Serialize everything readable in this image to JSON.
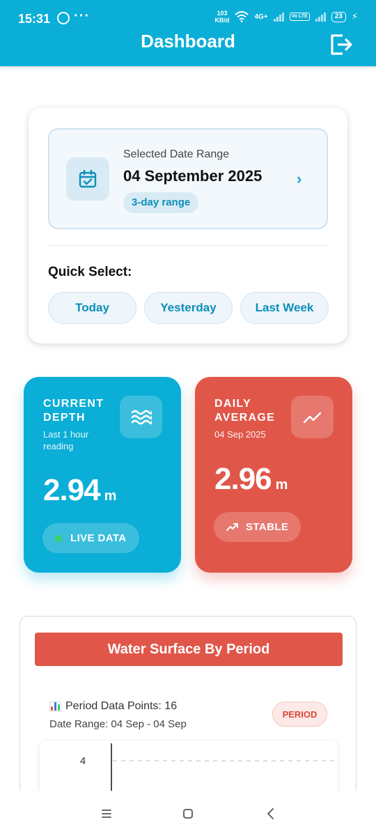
{
  "status": {
    "time": "15:31",
    "speed_value": "103",
    "speed_unit": "KB/d",
    "network": "4G+",
    "volte": "Vo LTE",
    "battery": "23"
  },
  "header": {
    "title": "Dashboard",
    "logout_icon": "logout-icon"
  },
  "date_range": {
    "label": "Selected Date Range",
    "value": "04 September 2025",
    "chip": "3-day range",
    "icon": "calendar-check-icon"
  },
  "quick_select": {
    "label": "Quick Select:",
    "options": [
      "Today",
      "Yesterday",
      "Last Week"
    ]
  },
  "current_depth": {
    "title": "CURRENT DEPTH",
    "subtitle": "Last 1 hour reading",
    "value": "2.94",
    "unit": "m",
    "badge": "LIVE DATA",
    "icon": "waves-icon",
    "color": "#0aaed6"
  },
  "daily_average": {
    "title": "DAILY AVERAGE",
    "subtitle": "04 Sep 2025",
    "value": "2.96",
    "unit": "m",
    "badge": "STABLE",
    "icon": "trend-up-icon",
    "color": "#e0574a"
  },
  "chart_section": {
    "banner": "Water Surface By Period",
    "points_label": "Period Data Points: 16",
    "date_range": "Date Range: 04 Sep - 04 Sep",
    "badge": "PERIOD",
    "y_tick": "4"
  },
  "chart_data": {
    "type": "line",
    "title": "",
    "y_ticks": [
      4
    ],
    "series": []
  },
  "nav": {
    "menu_icon": "menu-icon",
    "home_icon": "home-icon",
    "back_icon": "back-icon"
  }
}
